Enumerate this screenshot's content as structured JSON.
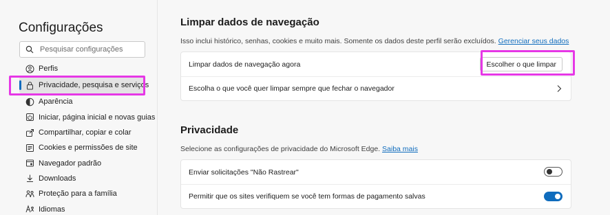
{
  "sidebar": {
    "title": "Configurações",
    "search_placeholder": "Pesquisar configurações",
    "items": [
      {
        "label": "Perfis",
        "icon": "profile-icon"
      },
      {
        "label": "Privacidade, pesquisa e serviços",
        "icon": "lock-icon",
        "selected": true
      },
      {
        "label": "Aparência",
        "icon": "appearance-icon"
      },
      {
        "label": "Iniciar, página inicial e novas guias",
        "icon": "power-icon"
      },
      {
        "label": "Compartilhar, copiar e colar",
        "icon": "share-icon"
      },
      {
        "label": "Cookies e permissões de site",
        "icon": "site-permissions-icon"
      },
      {
        "label": "Navegador padrão",
        "icon": "browser-icon"
      },
      {
        "label": "Downloads",
        "icon": "download-icon"
      },
      {
        "label": "Proteção para a família",
        "icon": "family-icon"
      },
      {
        "label": "Idiomas",
        "icon": "language-icon"
      }
    ]
  },
  "clear_section": {
    "title": "Limpar dados de navegação",
    "desc_text": "Isso inclui histórico, senhas, cookies e muito mais. Somente os dados deste perfil serão excluídos.",
    "desc_link": "Gerenciar seus dados",
    "row1_label": "Limpar dados de navegação agora",
    "row1_button": "Escolher o que limpar",
    "row2_label": "Escolha o que você quer limpar sempre que fechar o navegador"
  },
  "privacy_section": {
    "title": "Privacidade",
    "desc_text": "Selecione as configurações de privacidade do Microsoft Edge.",
    "desc_link": "Saiba mais",
    "row1_label": "Enviar solicitações \"Não Rastrear\"",
    "row1_toggle": false,
    "row2_label": "Permitir que os sites verifiquem se você tem formas de pagamento salvas",
    "row2_toggle": true
  },
  "colors": {
    "accent": "#0f6cbd",
    "highlight": "#e637e6"
  }
}
